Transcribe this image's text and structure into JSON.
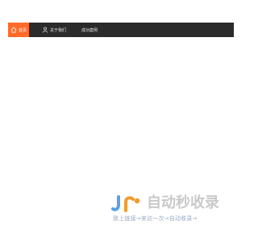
{
  "navbar": {
    "items": [
      {
        "label": "首页",
        "icon": "home-icon",
        "active": true
      },
      {
        "label": "关于我们",
        "icon": "user-icon",
        "active": false
      },
      {
        "label": "成功案例",
        "icon": "",
        "active": false
      }
    ]
  },
  "logo": {
    "mark": "JR",
    "title": "自动秒收录",
    "slogan": "致上链接→来访一次→自动收录→"
  },
  "colors": {
    "navbar_bg": "#2b2b2b",
    "active_tab": "#ff6a2a",
    "logo_j": "#5aa0e6",
    "logo_r": "#f29b2c",
    "logo_text": "#c9c9c9",
    "slogan_text": "#9aa9c4"
  }
}
